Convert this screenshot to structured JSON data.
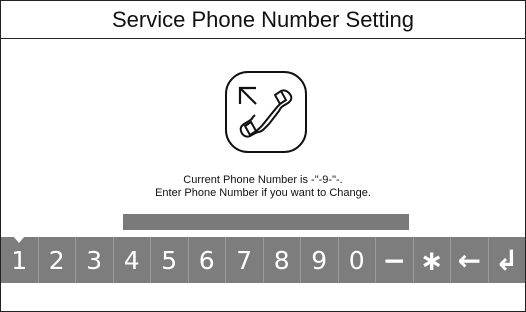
{
  "screen": {
    "title": "Service Phone Number Setting"
  },
  "icon": {
    "name": "phone-handset-icon"
  },
  "message": {
    "current": "Current Phone Number is -\"-9-\"-.",
    "instruction": "Enter Phone Number if you want to Change."
  },
  "entry": {
    "value": ""
  },
  "keypad": {
    "selected_index": 0,
    "keys": [
      "1",
      "2",
      "3",
      "4",
      "5",
      "6",
      "7",
      "8",
      "9",
      "0",
      "−",
      "∗",
      "←",
      "↲"
    ]
  },
  "colors": {
    "key_background": "#7d7d7d",
    "entry_bar": "#7a7a7a",
    "key_text": "#ffffff"
  }
}
